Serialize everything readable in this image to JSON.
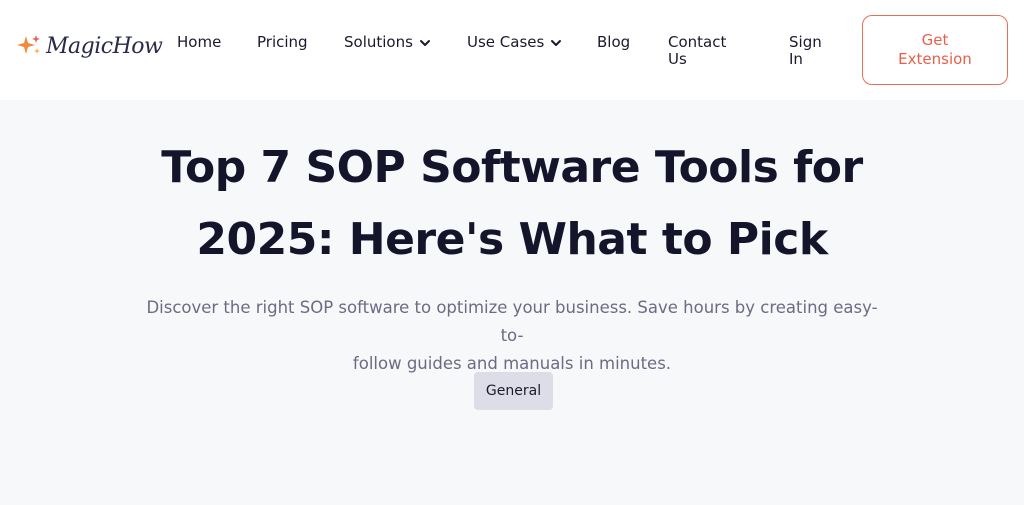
{
  "nav": {
    "logo_text": "MagicHow",
    "items": [
      {
        "label": "Home"
      },
      {
        "label": "Pricing"
      },
      {
        "label": "Solutions"
      },
      {
        "label": "Use Cases"
      },
      {
        "label": "Blog"
      },
      {
        "label": "Contact Us",
        "line1": "Contact",
        "line2": "Us"
      },
      {
        "label": "Sign In",
        "line1": "Sign",
        "line2": "In"
      }
    ],
    "cta": {
      "line1": "Get",
      "line2": "Extension"
    }
  },
  "hero": {
    "title_line1": "Top 7 SOP Software Tools for",
    "title_line2": "2025: Here's What to Pick",
    "subtitle_line1": "Discover the right SOP software to optimize your business. Save hours by creating easy-to-",
    "subtitle_line2": "follow guides and manuals in minutes.",
    "tag": "General"
  },
  "colors": {
    "accent": "#e8604a",
    "text": "#14142b",
    "muted": "#6b6b85",
    "tag_bg": "#dcdde7",
    "page_bg": "#f7f8fa"
  },
  "icons": [
    "sparkle-logo-icon",
    "chevron-down-icon"
  ]
}
